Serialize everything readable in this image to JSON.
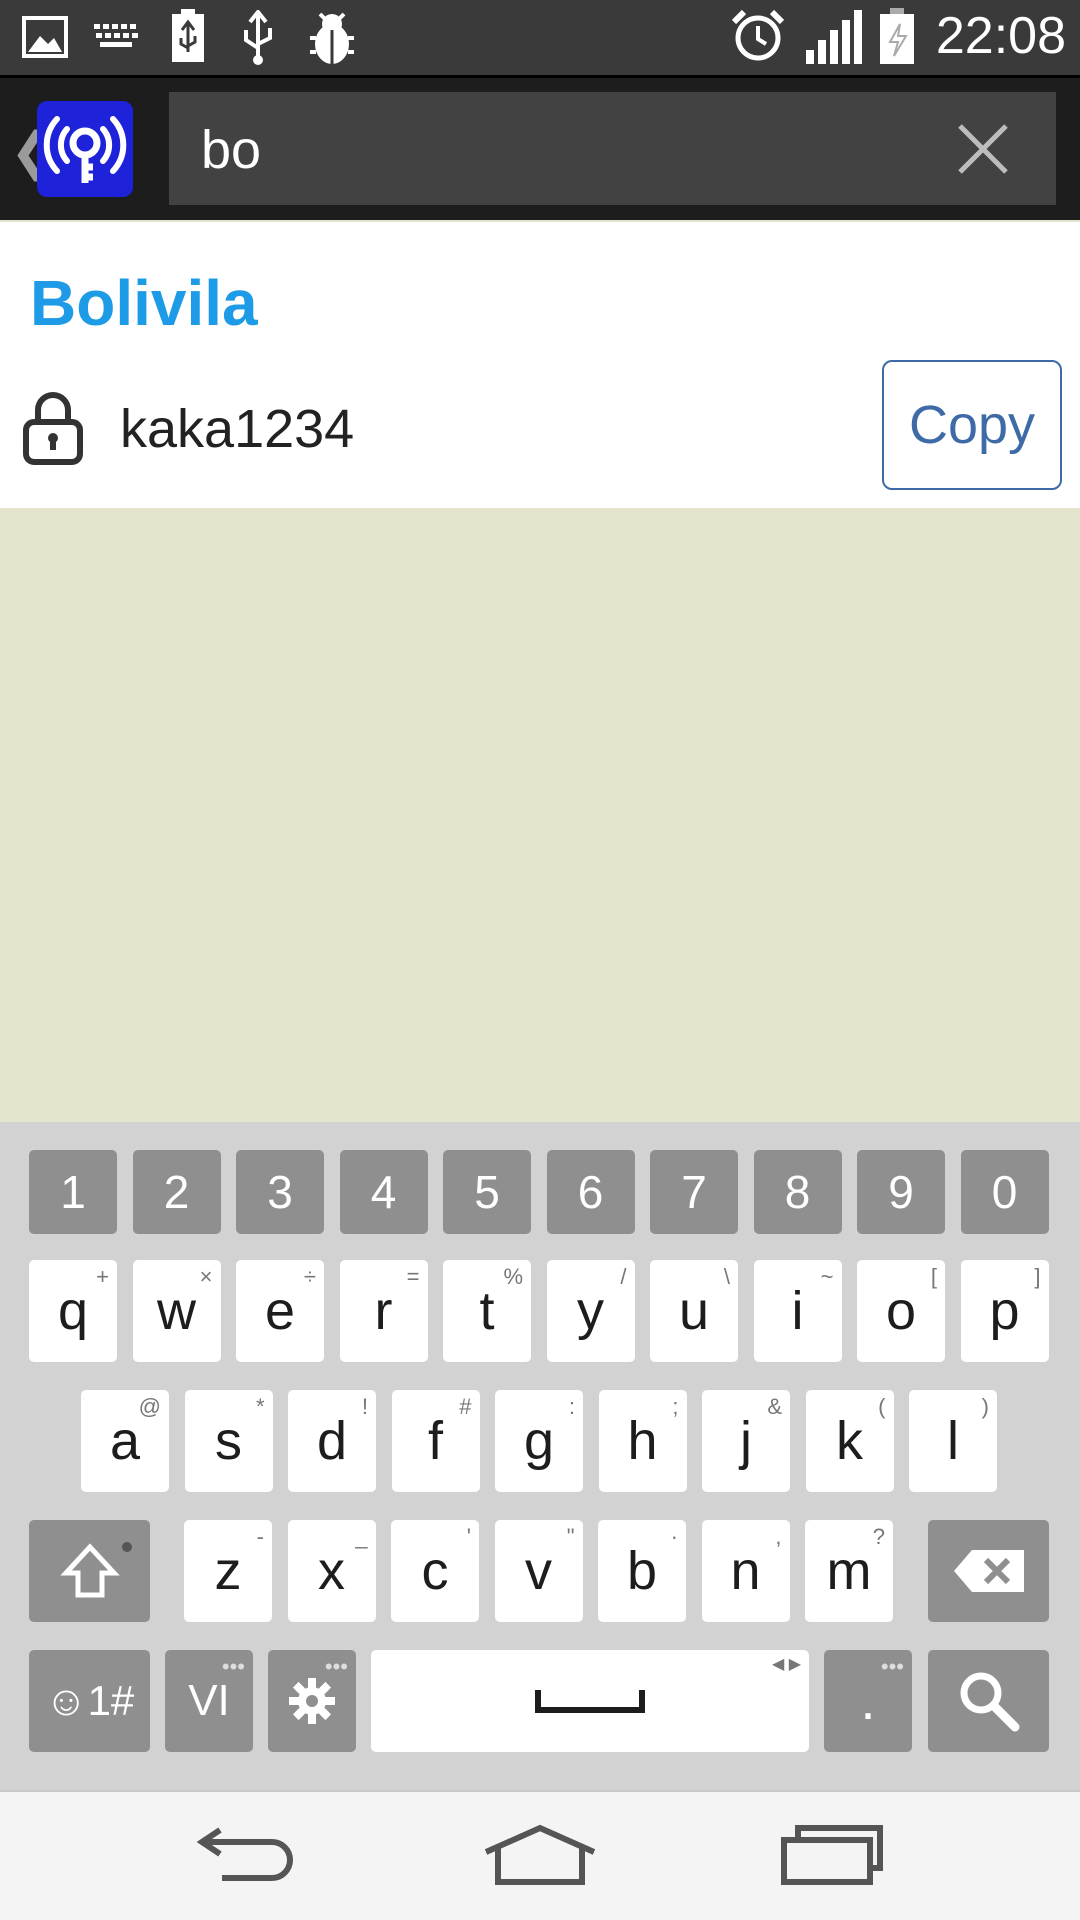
{
  "status_bar": {
    "time": "22:08",
    "icons": [
      "gallery-icon",
      "keyboard-icon",
      "usb-battery-icon",
      "usb-icon",
      "bug-icon",
      "alarm-icon",
      "signal-icon",
      "battery-charging-icon"
    ]
  },
  "app_bar": {
    "back_chevron": "❮",
    "search": {
      "value": "bo"
    }
  },
  "result": {
    "title": "Bolivila",
    "password": "kaka1234",
    "copy_label": "Copy"
  },
  "keyboard": {
    "numbers": [
      "1",
      "2",
      "3",
      "4",
      "5",
      "6",
      "7",
      "8",
      "9",
      "0"
    ],
    "row1": [
      [
        "q",
        "+"
      ],
      [
        "w",
        "×"
      ],
      [
        "e",
        "÷"
      ],
      [
        "r",
        "="
      ],
      [
        "t",
        "%"
      ],
      [
        "y",
        "/"
      ],
      [
        "u",
        "\\"
      ],
      [
        "i",
        "~"
      ],
      [
        "o",
        "["
      ],
      [
        "p",
        "]"
      ]
    ],
    "row2": [
      [
        "a",
        "@"
      ],
      [
        "s",
        "*"
      ],
      [
        "d",
        "!"
      ],
      [
        "f",
        "#"
      ],
      [
        "g",
        ":"
      ],
      [
        "h",
        ";"
      ],
      [
        "j",
        "&"
      ],
      [
        "k",
        "("
      ],
      [
        "l",
        ")"
      ]
    ],
    "row3": [
      [
        "z",
        "-"
      ],
      [
        "x",
        "_"
      ],
      [
        "c",
        "'"
      ],
      [
        "v",
        "\""
      ],
      [
        "b",
        "·"
      ],
      [
        "n",
        ","
      ],
      [
        "m",
        "?"
      ]
    ],
    "symbols_label": "☺1#",
    "lang_label": "VI",
    "period_label": "."
  }
}
